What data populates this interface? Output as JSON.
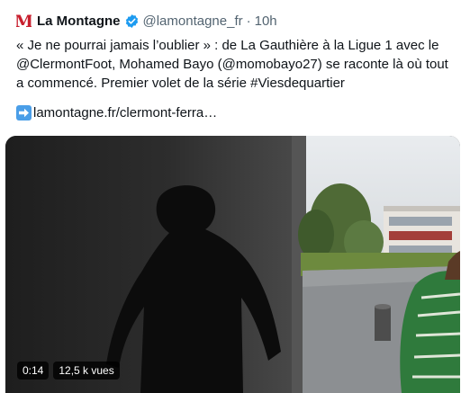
{
  "tweet": {
    "author": {
      "name": "La Montagne",
      "logo_letter": "M",
      "handle": "@lamontagne_fr",
      "separator": "·",
      "time": "10h"
    },
    "text_lines": [
      "« Je ne pourrai jamais l’oublier » : de La Gauthière à la Ligue 1 avec le",
      "@ClermontFoot, Mohamed Bayo (@momobayo27) se raconte là où tout",
      "a commencé. Premier volet de la série #Viesdequartier"
    ],
    "link_text": "lamontagne.fr/clermont-ferra…",
    "media": {
      "duration": "0:14",
      "views": "12,5 k vues"
    }
  },
  "colors": {
    "brand_logo": "#c8202f",
    "verified": "#1d9bf0",
    "secondary_text": "#536471",
    "link_arrow": "#4a9ee8"
  },
  "icons": [
    "la-montagne-logo-icon",
    "verified-badge-icon",
    "arrow-right-icon"
  ]
}
